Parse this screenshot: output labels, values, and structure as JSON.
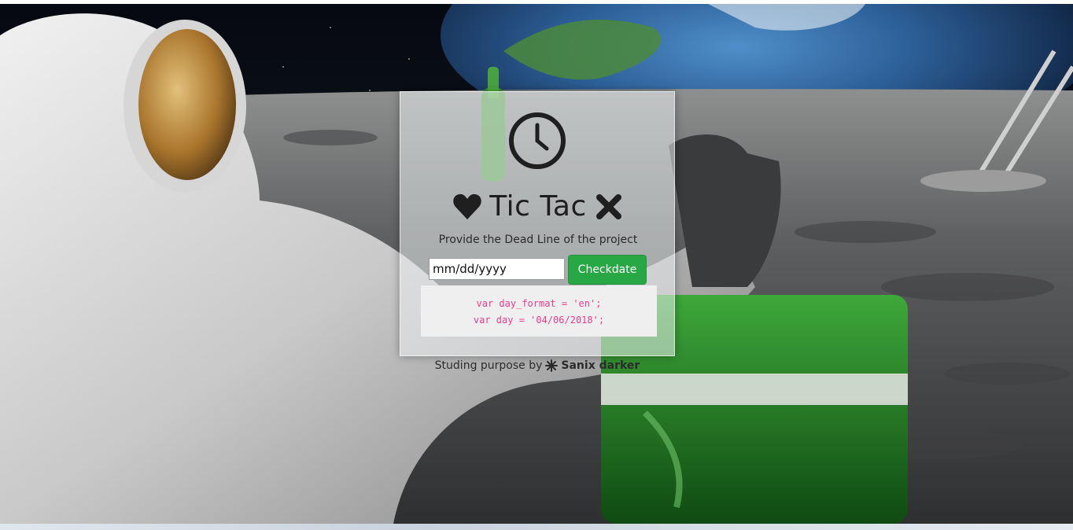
{
  "app": {
    "title": "Tic Tac",
    "subtitle": "Provide the Dead Line of the project"
  },
  "form": {
    "date_placeholder": "mm/dd/yyyy",
    "date_value": "",
    "submit_label": "Checkdate"
  },
  "code": {
    "lines": [
      "var day_format = 'en';",
      "var day = '04/06/2018';"
    ]
  },
  "footer": {
    "prefix": "Studing purpose by",
    "author": "Sanix darker"
  },
  "icons": {
    "header": "clock-icon",
    "title_left": "heart-icon",
    "title_right": "x-icon",
    "footer": "snowflake-icon"
  },
  "colors": {
    "button": "#28a745",
    "code_text": "#e83e8c",
    "card_bg": "rgba(235,238,240,0.55)"
  }
}
